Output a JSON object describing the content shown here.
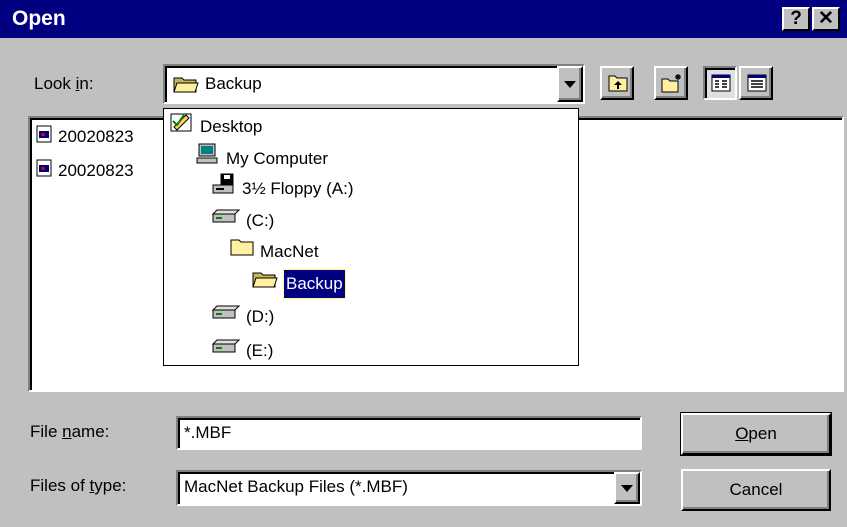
{
  "window": {
    "title": "Open",
    "help_glyph": "?",
    "close_glyph": "✕"
  },
  "look_in": {
    "label": "Look in:",
    "mnemonic": "i",
    "selected": "Backup"
  },
  "toolbar": {
    "icons": [
      "up-one-level-icon",
      "create-new-folder-icon",
      "list-view-icon",
      "details-view-icon"
    ]
  },
  "dropdown": {
    "items": [
      {
        "label": "Desktop",
        "icon": "desktop-icon"
      },
      {
        "label": "My Computer",
        "icon": "my-computer-icon"
      },
      {
        "label": "3½ Floppy (A:)",
        "icon": "floppy-drive-icon"
      },
      {
        "label": "(C:)",
        "icon": "hard-drive-icon"
      },
      {
        "label": "MacNet",
        "icon": "folder-icon"
      },
      {
        "label": "Backup",
        "icon": "open-folder-icon",
        "selected": true
      },
      {
        "label": "(D:)",
        "icon": "hard-drive-icon"
      },
      {
        "label": "(E:)",
        "icon": "hard-drive-icon"
      }
    ]
  },
  "files": [
    {
      "name": "20020823",
      "icon": "mbf-file-icon"
    },
    {
      "name": "20020823",
      "icon": "mbf-file-icon"
    }
  ],
  "file_name": {
    "label": "File name:",
    "mnemonic": "n",
    "value": "*.MBF"
  },
  "file_type": {
    "label": "Files of type:",
    "mnemonic": "t",
    "value": "MacNet Backup Files (*.MBF)"
  },
  "buttons": {
    "open": "Open",
    "open_mnemonic": "O",
    "cancel": "Cancel"
  },
  "colors": {
    "titlebar": "#000080",
    "face": "#c0c0c0",
    "selection": "#000080"
  }
}
